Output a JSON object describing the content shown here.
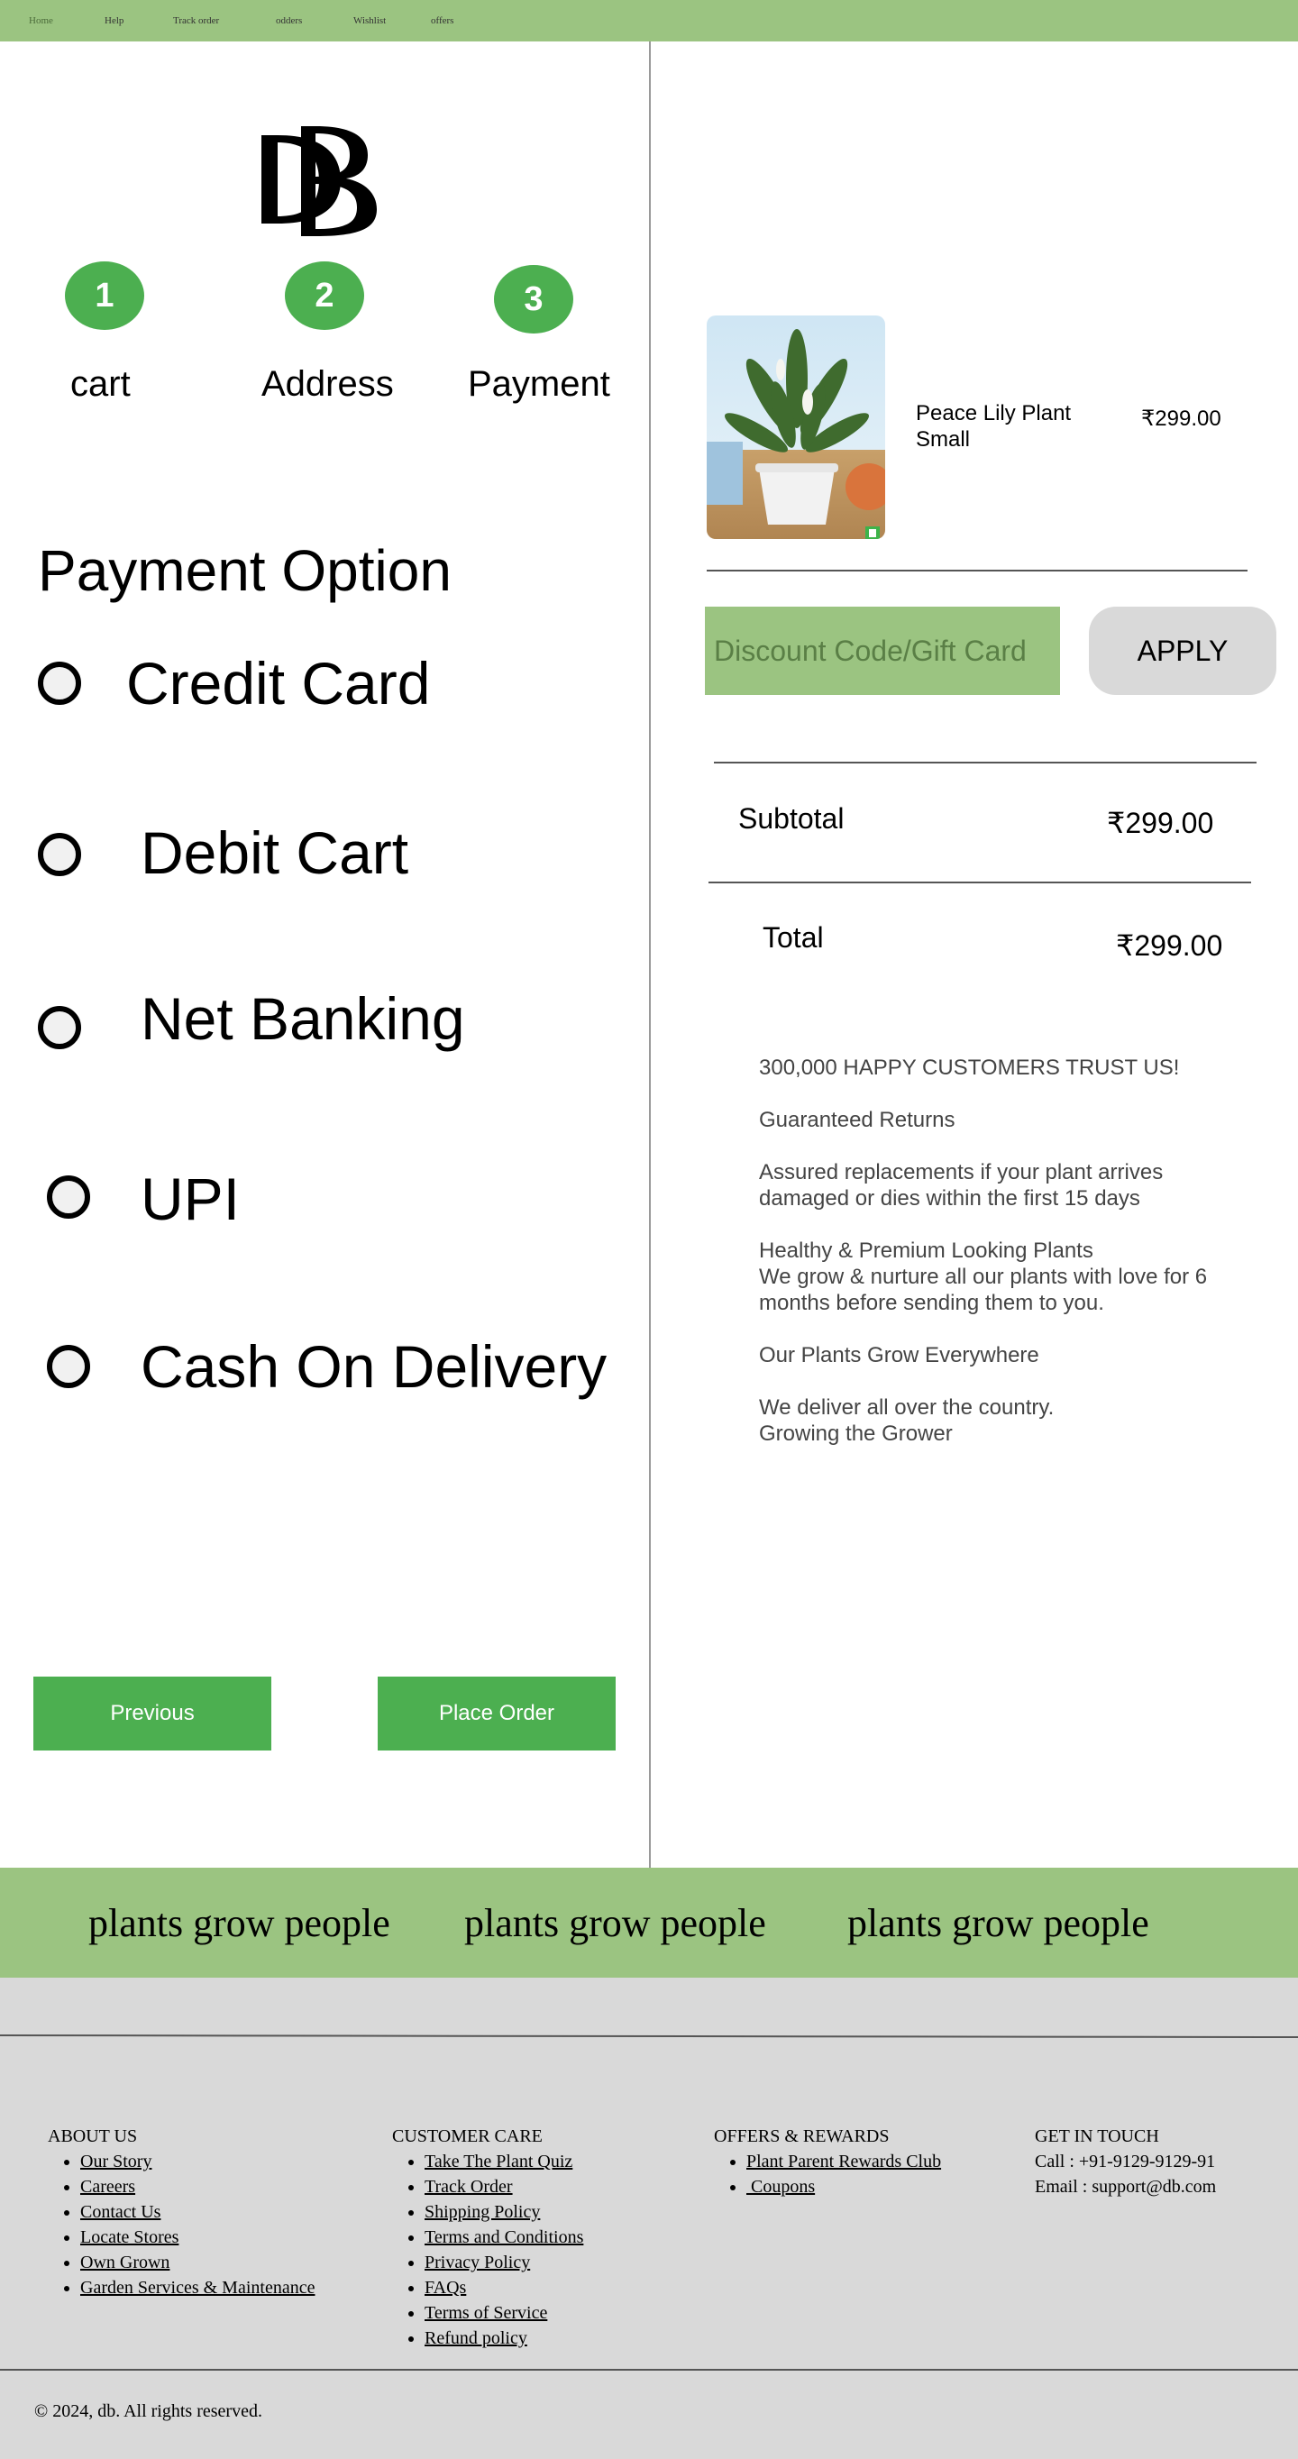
{
  "nav": {
    "items": [
      "Home",
      "Help",
      "Track order",
      "odders",
      "Wishlist",
      "offers"
    ]
  },
  "logo": {
    "text": "DB"
  },
  "steps": [
    {
      "number": "1",
      "label": "cart"
    },
    {
      "number": "2",
      "label": "Address"
    },
    {
      "number": "3",
      "label": "Payment"
    }
  ],
  "payment": {
    "title": "Payment Option",
    "options": [
      "Credit Card",
      "Debit Cart",
      "Net Banking",
      "UPI",
      "Cash On Delivery"
    ]
  },
  "actions": {
    "previous": "Previous",
    "place_order": "Place Order"
  },
  "product": {
    "name": "Peace Lily Plant Small",
    "price": "₹299.00"
  },
  "discount": {
    "placeholder": "Discount Code/Gift Card",
    "apply": "APPLY"
  },
  "summary": {
    "subtotal_label": "Subtotal",
    "subtotal_value": "₹299.00",
    "total_label": "Total",
    "total_value": "₹299.00"
  },
  "trust": [
    "300,000 HAPPY CUSTOMERS TRUST US!",
    "Guaranteed Returns",
    "Assured replacements if your plant arrives damaged or dies within the first 15 days",
    "Healthy & Premium Looking Plants\nWe grow & nurture all our plants with love for 6 months before sending them to you.",
    "Our Plants Grow Everywhere",
    "We deliver all over the country.\nGrowing the Grower"
  ],
  "tagline": [
    "plants grow people",
    "plants grow people",
    "plants grow people"
  ],
  "footer": {
    "about": {
      "title": "ABOUT US",
      "links": [
        "Our Story",
        "Careers",
        "Contact Us",
        "Locate Stores",
        "Own Grown",
        "Garden Services & Maintenance"
      ]
    },
    "care": {
      "title": "CUSTOMER CARE",
      "links": [
        "Take The Plant Quiz",
        "Track Order",
        "Shipping Policy",
        "Terms and Conditions",
        "Privacy Policy",
        "FAQs",
        "Terms of Service",
        "Refund policy"
      ]
    },
    "offers": {
      "title": "OFFERS & REWARDS",
      "links": [
        "Plant Parent Rewards Club",
        " Coupons"
      ]
    },
    "contact": {
      "title": "GET IN TOUCH",
      "phone": "Call : +91-9129-9129-91",
      "email": "Email : support@db.com"
    },
    "copyright": "© 2024, db. All rights reserved."
  },
  "colors": {
    "accent_green": "#4caf50",
    "light_green": "#9bc481",
    "footer_gray": "#d9d9d9"
  }
}
